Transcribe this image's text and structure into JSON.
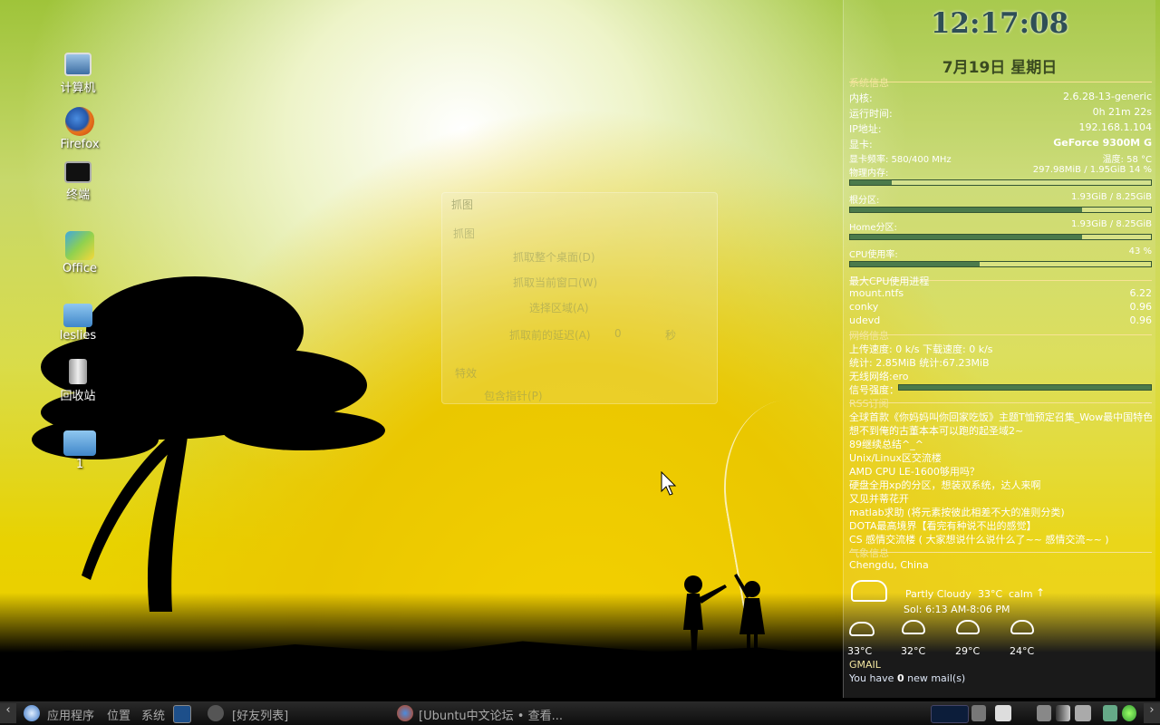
{
  "desktop": {
    "icons": [
      {
        "label": "计算机"
      },
      {
        "label": "Firefox"
      },
      {
        "label": "终端"
      },
      {
        "label": "Office"
      },
      {
        "label": "leslies"
      },
      {
        "label": "回收站"
      },
      {
        "label": "1"
      }
    ]
  },
  "ghost_dialog": {
    "title": "抓图",
    "section": "抓图",
    "opt_full": "抓取整个桌面(D)",
    "opt_window": "抓取当前窗口(W)",
    "opt_area": "选择区域(A)",
    "delay_label": "抓取前的延迟(A)",
    "delay_value": "0",
    "delay_unit": "秒",
    "effects": "特效",
    "include_pointer": "包含指针(P)"
  },
  "conky": {
    "time": "12:17:08",
    "date": "7月19日 星期日",
    "system": {
      "header": "系统信息",
      "rows": [
        {
          "k": "内核:",
          "v": "2.6.28-13-generic"
        },
        {
          "k": "运行时间:",
          "v": "0h 21m 22s"
        },
        {
          "k": "IP地址:",
          "v": "192.168.1.104"
        },
        {
          "k": "显卡:",
          "v": "GeForce 9300M G"
        }
      ],
      "gpu_freq_label": "显卡频率: 580/400 MHz",
      "gpu_temp": "温度: 58 °C",
      "mem_label": "物理内存:",
      "mem_value": "297.98MiB / 1.95GiB  14 %",
      "mem_percent": 14,
      "root_label": "根分区:",
      "root_value": "1.93GiB  / 8.25GiB",
      "root_fraction": 0.77,
      "home_label": "Home分区:",
      "home_value": "1.93GiB  / 8.25GiB",
      "home_fraction": 0.77,
      "cpu_label": "CPU使用率:",
      "cpu_value": "43 %",
      "cpu_percent": 43
    },
    "processes": {
      "header": "最大CPU使用进程",
      "items": [
        {
          "name": "mount.ntfs",
          "value": "6.22"
        },
        {
          "name": "conky",
          "value": "0.96"
        },
        {
          "name": "udevd",
          "value": "0.96"
        }
      ]
    },
    "network": {
      "header": "网络信息",
      "speed": "上传速度: 0    k/s 下载速度: 0    k/s",
      "totals": "统计: 2.85MiB       统计:67.23MiB",
      "wifi": "无线网络:ero",
      "signal_label": "信号强度：",
      "signal_percent": 100
    },
    "rss": {
      "header": "RSS订阅",
      "items": [
        "全球首款《你妈妈叫你回家吃饭》主题T恤预定召集_Wow最中国特色",
        "想不到俺的古董本本可以跑的起圣域2~",
        "89继续总结^_^",
        "Unix/Linux区交流楼",
        "AMD CPU LE-1600够用吗？",
        "硬盘全用xp的分区，想装双系统，达人来啊",
        "又见并蒂花开",
        "matlab求助 (将元素按彼此相差不大的准则分类)",
        "DOTA最高境界【看完有种说不出的感觉】",
        "CS 感情交流楼 ( 大家想说什么说什么了~~ 感情交流~~ )"
      ]
    },
    "weather": {
      "header": "气象信息",
      "location": "Chengdu, China",
      "condition": "Partly Cloudy",
      "temp": "33°C",
      "wind": "calm",
      "sun": "Sol: 6:13 AM-8:06 PM",
      "forecast": [
        "33°C",
        "32°C",
        "29°C",
        "24°C"
      ]
    },
    "gmail": {
      "header": "GMAIL",
      "prefix": "You have ",
      "count": "0",
      "suffix": " new mail(s)"
    }
  },
  "taskbar": {
    "apps": "应用程序",
    "places": "位置",
    "system": "系统",
    "task1": "[好友列表]",
    "task2": "[Ubuntu中文论坛 • 查看..."
  }
}
